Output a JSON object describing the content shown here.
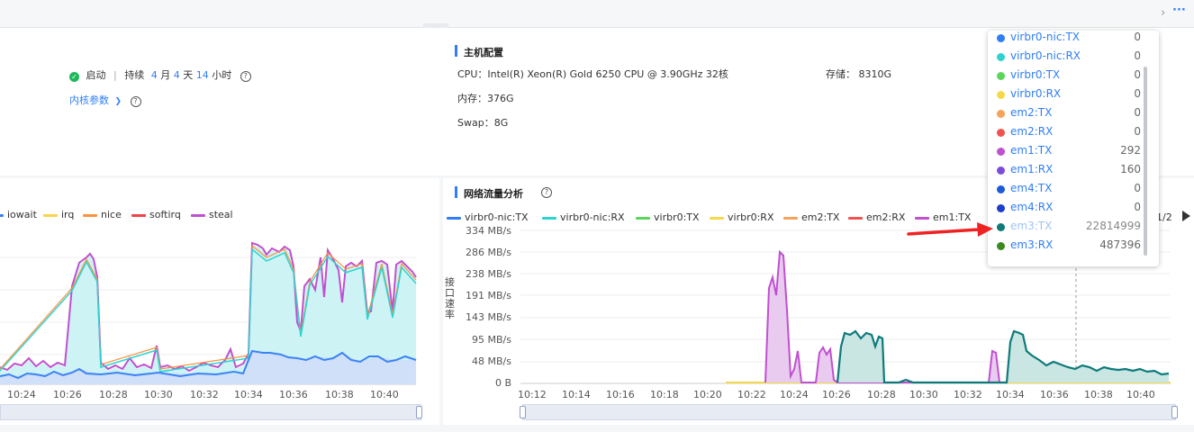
{
  "topbar": {
    "chevron": "›",
    "more": "···",
    "collapse": "⌄"
  },
  "status": {
    "state": "启动",
    "duration_prefix": "持续",
    "months": "4",
    "month_unit": "月",
    "days": "4",
    "day_unit": "天",
    "hours": "14",
    "hour_unit": "小时",
    "kernel_link": "内核参数",
    "kernel_chevron": "❯",
    "help": "?"
  },
  "host": {
    "title": "主机配置",
    "cpu": "CPU：Intel(R) Xeon(R) Gold 6250 CPU @ 3.90GHz 32核",
    "storage": "存储：  8310G",
    "memory": "内存：376G",
    "swap": "Swap：8G"
  },
  "cpu_chart": {
    "legend": [
      {
        "name": "iowait",
        "color": "#3b82f6"
      },
      {
        "name": "irq",
        "color": "#fcd34d"
      },
      {
        "name": "nice",
        "color": "#fb923c"
      },
      {
        "name": "softirq",
        "color": "#ef4444"
      },
      {
        "name": "steal",
        "color": "#c050d0"
      }
    ],
    "xticks": [
      "10:24",
      "10:26",
      "10:28",
      "10:30",
      "10:32",
      "10:34",
      "10:36",
      "10:38",
      "10:40"
    ]
  },
  "net_chart": {
    "title": "网络流量分析",
    "help": "?",
    "ylabel": "接口速率",
    "legend": [
      {
        "name": "virbr0-nic:TX",
        "color": "#2f7ef7"
      },
      {
        "name": "virbr0-nic:RX",
        "color": "#2ed3d0"
      },
      {
        "name": "virbr0:TX",
        "color": "#5ad65a"
      },
      {
        "name": "virbr0:RX",
        "color": "#f5d94a"
      },
      {
        "name": "em2:TX",
        "color": "#f6a35a"
      },
      {
        "name": "em2:RX",
        "color": "#ef5350"
      },
      {
        "name": "em1:TX",
        "color": "#c050d0"
      }
    ],
    "legend_page": "1/2",
    "yticks": [
      "334 MB/s",
      "286 MB/s",
      "238 MB/s",
      "191 MB/s",
      "143 MB/s",
      "95 MB/s",
      "48 MB/s",
      "0 B"
    ],
    "xticks": [
      "10:12",
      "10:14",
      "10:16",
      "10:18",
      "10:20",
      "10:22",
      "10:24",
      "10:26",
      "10:28",
      "10:30",
      "10:32",
      "10:34",
      "10:36",
      "10:38",
      "10:40"
    ]
  },
  "tooltip": {
    "rows": [
      {
        "name": "virbr0-nic:TX",
        "value": "0",
        "color": "#2f7ef7"
      },
      {
        "name": "virbr0-nic:RX",
        "value": "0",
        "color": "#2ed3d0"
      },
      {
        "name": "virbr0:TX",
        "value": "0",
        "color": "#5ad65a"
      },
      {
        "name": "virbr0:RX",
        "value": "0",
        "color": "#f5d94a"
      },
      {
        "name": "em2:TX",
        "value": "0",
        "color": "#f6a35a"
      },
      {
        "name": "em2:RX",
        "value": "0",
        "color": "#ef5350"
      },
      {
        "name": "em1:TX",
        "value": "292",
        "color": "#c050d0"
      },
      {
        "name": "em1:RX",
        "value": "160",
        "color": "#7c4ddc"
      },
      {
        "name": "em4:TX",
        "value": "0",
        "color": "#1e5bd6"
      },
      {
        "name": "em4:RX",
        "value": "0",
        "color": "#1b3fcc"
      },
      {
        "name": "em3:TX",
        "value": "22814999",
        "color": "#0e7a7a"
      },
      {
        "name": "em3:RX",
        "value": "487396",
        "color": "#3a8a1e"
      }
    ]
  }
}
